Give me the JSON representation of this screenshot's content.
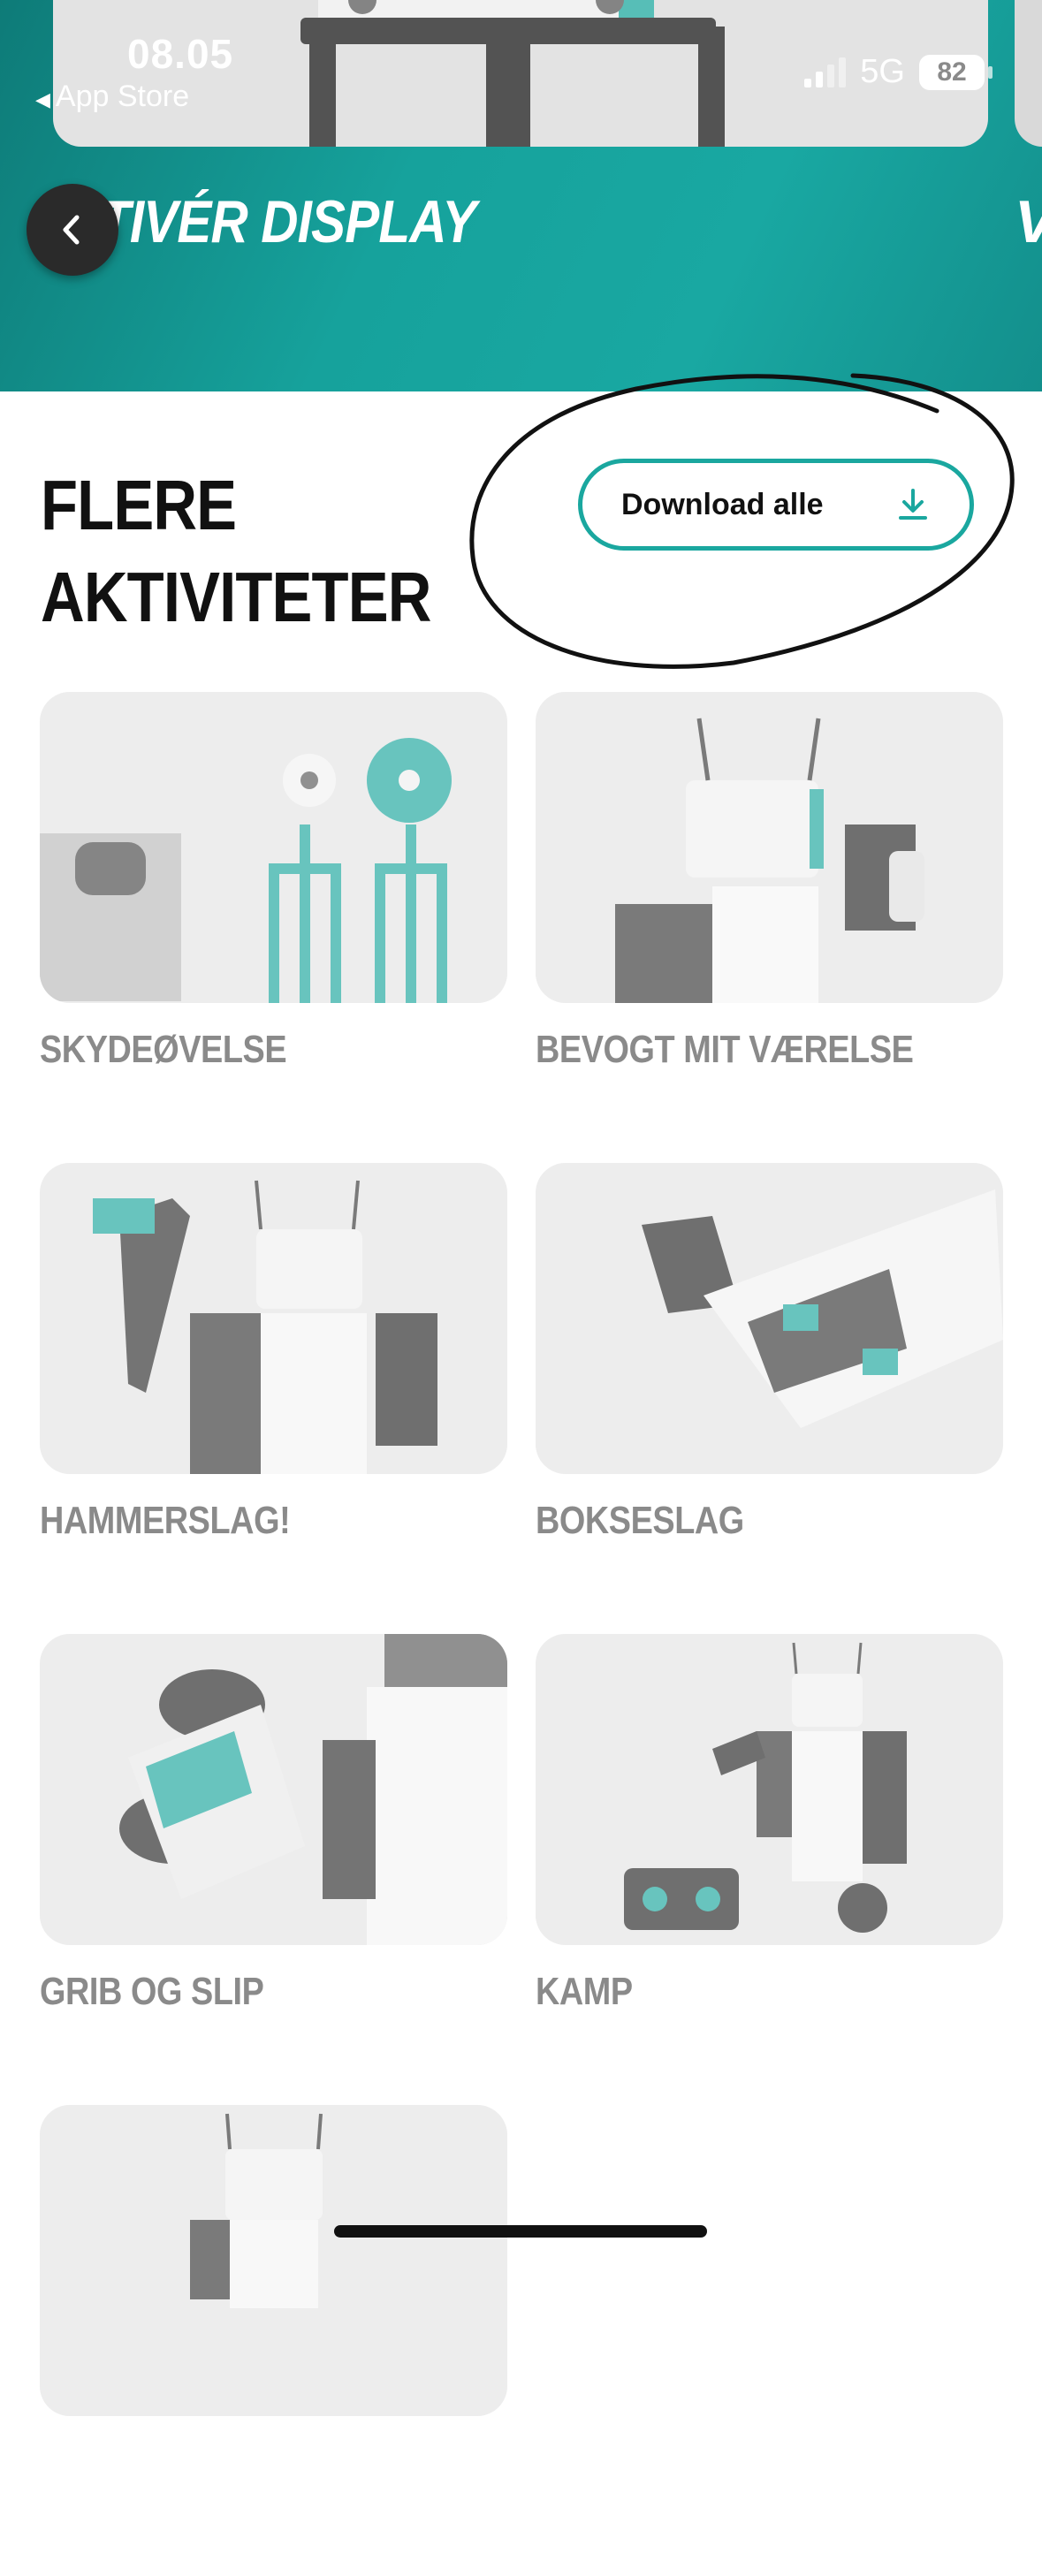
{
  "status_bar": {
    "time": "08.05",
    "back_app": "App Store",
    "network": "5G",
    "battery": "82"
  },
  "hero": {
    "title": "TIVÉR DISPLAY",
    "next_title_fragment": "V"
  },
  "section": {
    "title_line1": "FLERE",
    "title_line2": "AKTIVITETER",
    "download_button": "Download alle"
  },
  "activities": [
    {
      "label": "SKYDEØVELSE"
    },
    {
      "label": "BEVOGT MIT VÆRELSE"
    },
    {
      "label": "HAMMERSLAG!"
    },
    {
      "label": "BOKSESLAG"
    },
    {
      "label": "GRIB OG SLIP"
    },
    {
      "label": "KAMP"
    },
    {
      "label": ""
    }
  ],
  "colors": {
    "accent": "#1aa79f",
    "header_teal": "#16a29c",
    "card_bg": "#e4e4e4",
    "label_grey": "#8a8a8a",
    "annotation": "#111111"
  },
  "icons": {
    "back": "chevron-left-icon",
    "download": "download-icon"
  }
}
